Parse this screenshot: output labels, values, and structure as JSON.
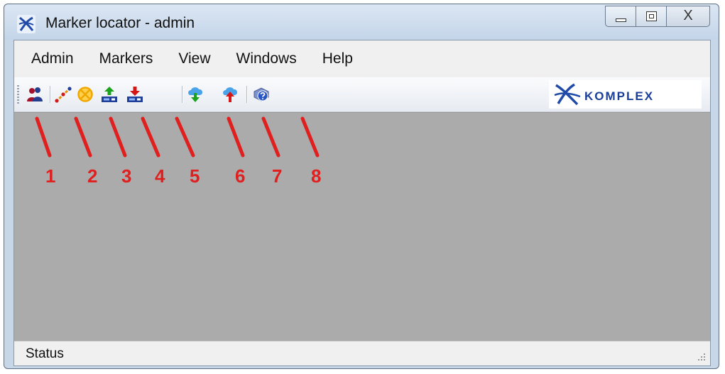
{
  "window": {
    "title": "Marker locator - admin",
    "close_glyph": "X"
  },
  "menu": [
    "Admin",
    "Markers",
    "View",
    "Windows",
    "Help"
  ],
  "toolbar": {
    "buttons": [
      {
        "icon": "users-icon"
      },
      {
        "icon": "route-line-icon"
      },
      {
        "icon": "crossed-circle-icon"
      },
      {
        "icon": "upload-to-device-icon"
      },
      {
        "icon": "download-from-device-icon"
      },
      {
        "icon": "cloud-download-icon"
      },
      {
        "icon": "cloud-upload-icon"
      },
      {
        "icon": "help-device-icon"
      }
    ],
    "logo_text": "KOMPLEX"
  },
  "annotations": [
    "1",
    "2",
    "3",
    "4",
    "5",
    "6",
    "7",
    "8"
  ],
  "status": {
    "text": "Status"
  },
  "colors": {
    "annotation": "#e01f1f",
    "workspace": "#ababab",
    "logo": "#1b3e99"
  }
}
